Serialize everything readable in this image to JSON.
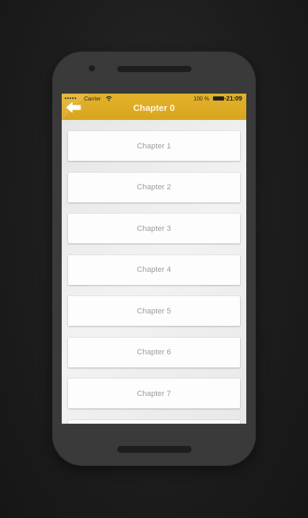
{
  "status_bar": {
    "signal_dots": "●●●●●",
    "carrier": "Carrier",
    "battery_percent": "100 %",
    "time": "21:09"
  },
  "navbar": {
    "title": "Chapter 0",
    "back_icon": "back-arrow-icon"
  },
  "chapters": [
    {
      "label": "Chapter 1"
    },
    {
      "label": "Chapter 2"
    },
    {
      "label": "Chapter 3"
    },
    {
      "label": "Chapter 4"
    },
    {
      "label": "Chapter 5"
    },
    {
      "label": "Chapter 6"
    },
    {
      "label": "Chapter 7"
    },
    {
      "label": ""
    }
  ],
  "colors": {
    "navbar": "#e0ad27",
    "phone_body": "#3a3a3a",
    "background": "#1d1d1d",
    "item_text": "#9b9b9b"
  }
}
